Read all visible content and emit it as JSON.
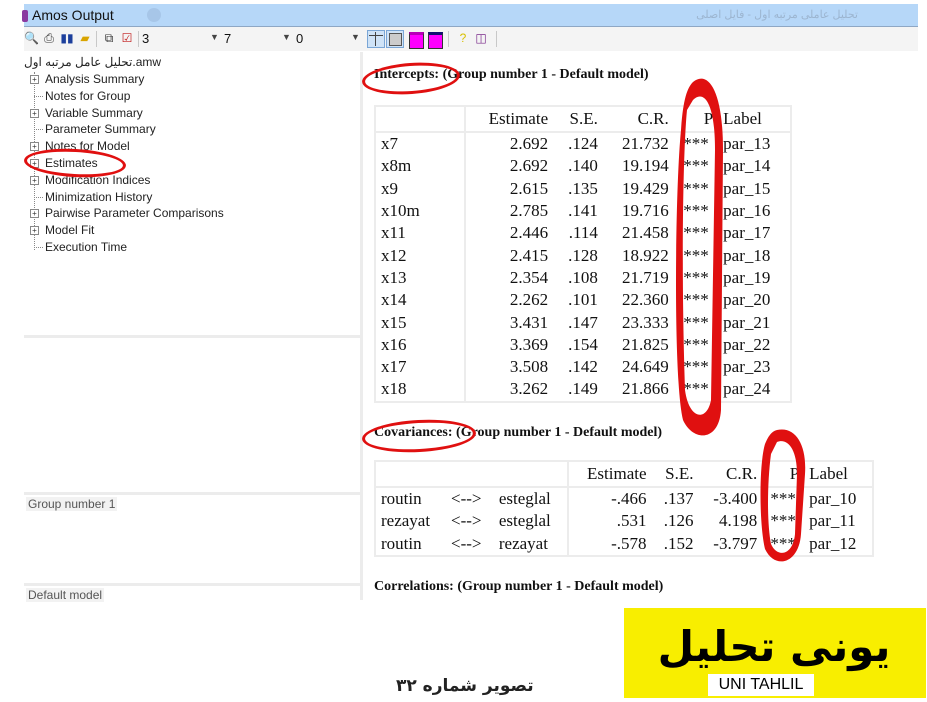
{
  "window": {
    "title": "Amos Output",
    "rtl_title": "تحلیل عاملی مرتبه اول - فایل اصلی"
  },
  "toolbar": {
    "icons": [
      "print-preview-icon",
      "print-icon",
      "book-icon",
      "open-folder-icon",
      "copy-icon",
      "options-check-icon"
    ],
    "decimal_value": "3",
    "column_spacing_value": "7",
    "table_font_value": "0",
    "view_buttons": [
      "grid-lines-button",
      "plain-table-button",
      "magenta-header-button",
      "navy-header-button"
    ],
    "help_icons": [
      "help-icon",
      "book-help-icon"
    ]
  },
  "tree": {
    "root": "تحلیل عامل مرتبه اول.amw",
    "items": [
      {
        "label": "Analysis Summary",
        "expandable": true
      },
      {
        "label": "Notes for Group",
        "expandable": false
      },
      {
        "label": "Variable Summary",
        "expandable": true
      },
      {
        "label": "Parameter Summary",
        "expandable": false
      },
      {
        "label": "Notes for Model",
        "expandable": true
      },
      {
        "label": "Estimates",
        "expandable": true,
        "highlighted": true
      },
      {
        "label": "Modification Indices",
        "expandable": true
      },
      {
        "label": "Minimization History",
        "expandable": false
      },
      {
        "label": "Pairwise Parameter Comparisons",
        "expandable": true
      },
      {
        "label": "Model Fit",
        "expandable": true
      },
      {
        "label": "Execution Time",
        "expandable": false
      }
    ]
  },
  "groups_pane": {
    "group": "Group number 1"
  },
  "models_pane": {
    "model": "Default model"
  },
  "intercepts": {
    "title_prefix": "Intercepts:",
    "title_rest": " (Group number 1 - Default model)",
    "headers": [
      "",
      "Estimate",
      "S.E.",
      "C.R.",
      "P",
      "Label"
    ],
    "rows": [
      [
        "x7",
        "2.692",
        ".124",
        "21.732",
        "***",
        "par_13"
      ],
      [
        "x8m",
        "2.692",
        ".140",
        "19.194",
        "***",
        "par_14"
      ],
      [
        "x9",
        "2.615",
        ".135",
        "19.429",
        "***",
        "par_15"
      ],
      [
        "x10m",
        "2.785",
        ".141",
        "19.716",
        "***",
        "par_16"
      ],
      [
        "x11",
        "2.446",
        ".114",
        "21.458",
        "***",
        "par_17"
      ],
      [
        "x12",
        "2.415",
        ".128",
        "18.922",
        "***",
        "par_18"
      ],
      [
        "x13",
        "2.354",
        ".108",
        "21.719",
        "***",
        "par_19"
      ],
      [
        "x14",
        "2.262",
        ".101",
        "22.360",
        "***",
        "par_20"
      ],
      [
        "x15",
        "3.431",
        ".147",
        "23.333",
        "***",
        "par_21"
      ],
      [
        "x16",
        "3.369",
        ".154",
        "21.825",
        "***",
        "par_22"
      ],
      [
        "x17",
        "3.508",
        ".142",
        "24.649",
        "***",
        "par_23"
      ],
      [
        "x18",
        "3.262",
        ".149",
        "21.866",
        "***",
        "par_24"
      ]
    ]
  },
  "covariances": {
    "title_prefix": "Covariances:",
    "title_rest": " (Group number 1 - Default model)",
    "headers": [
      "",
      "",
      "",
      "Estimate",
      "S.E.",
      "C.R.",
      "P",
      "Label"
    ],
    "rows": [
      [
        "routin",
        "<-->",
        "esteglal",
        "-.466",
        ".137",
        "-3.400",
        "***",
        "par_10"
      ],
      [
        "rezayat",
        "<-->",
        "esteglal",
        ".531",
        ".126",
        "4.198",
        "***",
        "par_11"
      ],
      [
        "routin",
        "<-->",
        "rezayat",
        "-.578",
        ".152",
        "-3.797",
        "***",
        "par_12"
      ]
    ]
  },
  "correlations": {
    "title": "Correlations: (Group number 1 - Default model)"
  },
  "caption": "تصویر شماره ۳۲",
  "logo": {
    "text_fa": "یونی تحلیل",
    "text_en": "UNI TAHLIL",
    "bg_color": "#f8ee00"
  },
  "annotation_color": "#e01010"
}
